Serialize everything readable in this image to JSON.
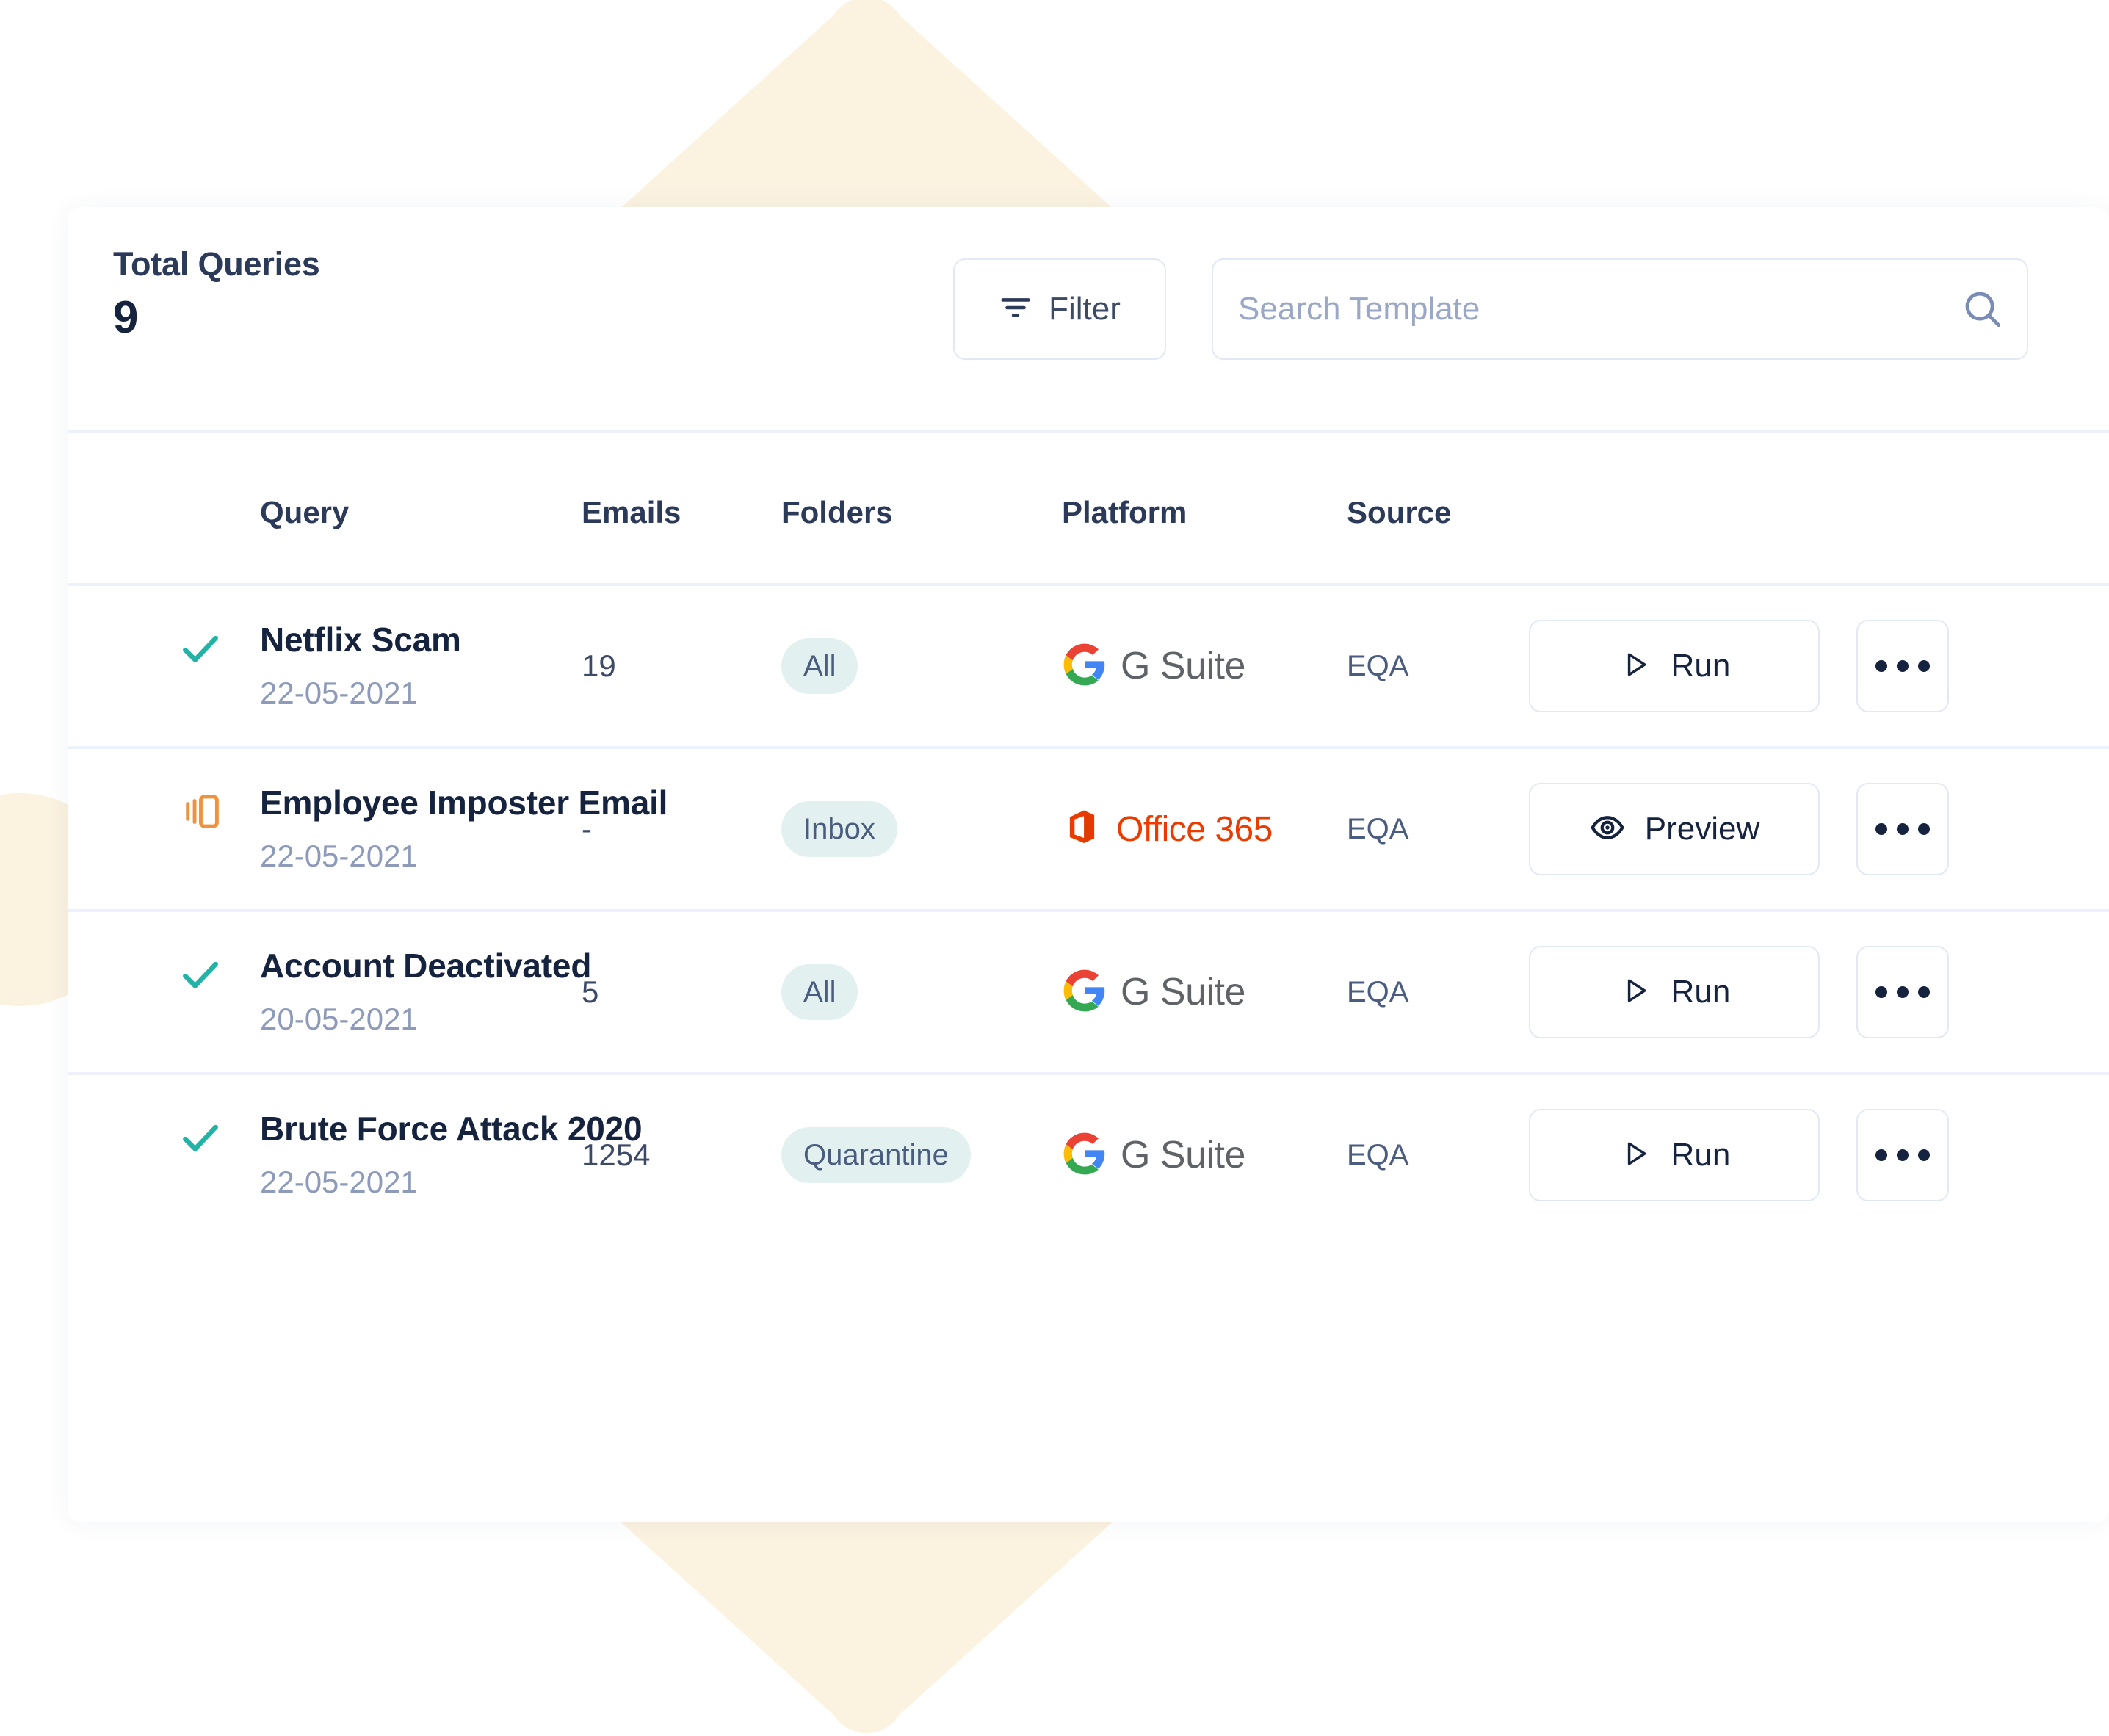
{
  "stats": {
    "total_queries_label": "Total Queries",
    "total_queries_value": "9"
  },
  "toolbar": {
    "filter_label": "Filter",
    "search_placeholder": "Search Template",
    "search_value": ""
  },
  "table": {
    "headers": {
      "query": "Query",
      "emails": "Emails",
      "folders": "Folders",
      "platform": "Platform",
      "source": "Source",
      "actions": ""
    },
    "rows": [
      {
        "status": "check",
        "title": "Netflix Scam",
        "date": "22-05-2021",
        "emails": "19",
        "folder": "All",
        "platform": "G Suite",
        "platform_kind": "gsuite",
        "source": "EQA",
        "action_label": "Run",
        "action_icon": "play-icon",
        "more_label": "..."
      },
      {
        "status": "draft",
        "title": "Employee Imposter Email",
        "date": "22-05-2021",
        "emails": "-",
        "folder": "Inbox",
        "platform": "Office 365",
        "platform_kind": "o365",
        "source": "EQA",
        "action_label": "Preview",
        "action_icon": "eye-icon",
        "more_label": "..."
      },
      {
        "status": "check",
        "title": "Account Deactivated",
        "date": "20-05-2021",
        "emails": "5",
        "folder": "All",
        "platform": "G Suite",
        "platform_kind": "gsuite",
        "source": "EQA",
        "action_label": "Run",
        "action_icon": "play-icon",
        "more_label": "..."
      },
      {
        "status": "check",
        "title": "Brute Force Attack 2020",
        "date": "22-05-2021",
        "emails": "1254",
        "folder": "Quarantine",
        "platform": "G Suite",
        "platform_kind": "gsuite",
        "source": "EQA",
        "action_label": "Run",
        "action_icon": "play-icon",
        "more_label": "..."
      }
    ]
  },
  "colors": {
    "accent_green": "#22B2A6",
    "accent_orange": "#F0913E",
    "badge_bg": "#E2F1F0",
    "text_dark": "#16233E",
    "text_muted": "#8D9AB9",
    "border": "#E3E8F5",
    "decor_cream": "#FBF2E0",
    "office_red": "#EB3C00"
  }
}
